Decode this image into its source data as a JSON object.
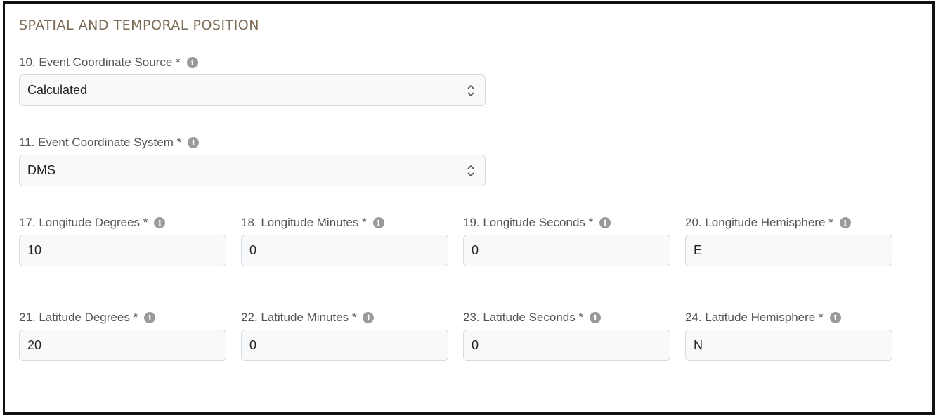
{
  "section": {
    "title": "SPATIAL AND TEMPORAL POSITION"
  },
  "fields": {
    "coordinate_source": {
      "label": "10. Event Coordinate Source *",
      "value": "Calculated"
    },
    "coordinate_system": {
      "label": "11. Event Coordinate System *",
      "value": "DMS"
    },
    "longitude_degrees": {
      "label": "17. Longitude Degrees *",
      "value": "10"
    },
    "longitude_minutes": {
      "label": "18. Longitude Minutes *",
      "value": "0"
    },
    "longitude_seconds": {
      "label": "19. Longitude Seconds *",
      "value": "0"
    },
    "longitude_hemisphere": {
      "label": "20. Longitude Hemisphere *",
      "value": "E"
    },
    "latitude_degrees": {
      "label": "21. Latitude Degrees *",
      "value": "20"
    },
    "latitude_minutes": {
      "label": "22. Latitude Minutes *",
      "value": "0"
    },
    "latitude_seconds": {
      "label": "23. Latitude Seconds *",
      "value": "0"
    },
    "latitude_hemisphere": {
      "label": "24. Latitude Hemisphere *",
      "value": "N"
    }
  },
  "icons": {
    "info": "info-icon",
    "select_arrows": "chevron-updown-icon"
  },
  "colors": {
    "section_title": "#7b6a55",
    "label": "#555555",
    "field_border": "#d6dbe0",
    "field_background": "#f8f9fb",
    "info_icon": "#9a9a9a",
    "frame_border": "#111111"
  }
}
